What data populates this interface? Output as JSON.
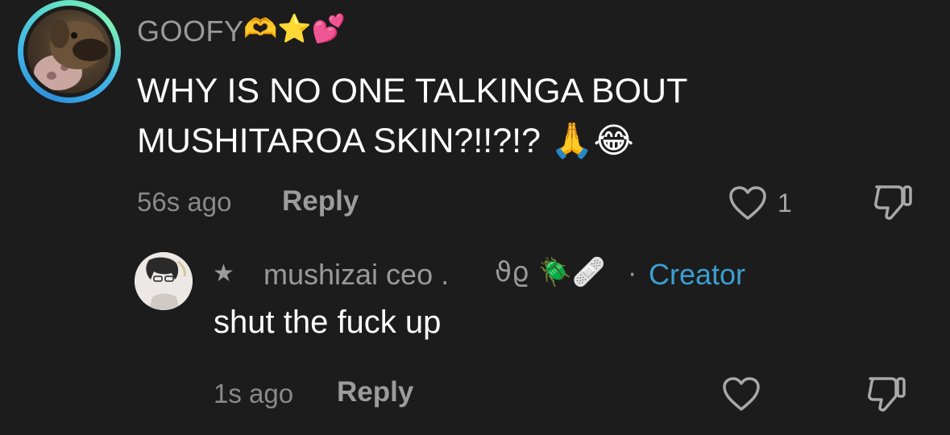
{
  "main_comment": {
    "username": "GOOFY",
    "username_emoji": "🫶⭐💕",
    "text": "WHY IS NO ONE TALKINGA BOUT MUSHITAROA SKIN?!!?!? 🙏😂",
    "time": "56s ago",
    "reply_label": "Reply",
    "like_count": "1"
  },
  "reply_comment": {
    "star": "★",
    "username": "mushizai ceo .",
    "username_decoration": "ϑϱ 🪲🩹",
    "separator": "·",
    "creator_label": "Creator",
    "text": "shut the fuck up",
    "time": "1s ago",
    "reply_label": "Reply"
  },
  "colors": {
    "background": "#1c1c1c",
    "secondary_text": "#9a9a9a",
    "creator_accent": "#3b9fd1",
    "avatar_ring": "#3fb4e8"
  },
  "icons": {
    "like": "heart-outline-icon",
    "dislike": "thumbs-down-outline-icon"
  }
}
